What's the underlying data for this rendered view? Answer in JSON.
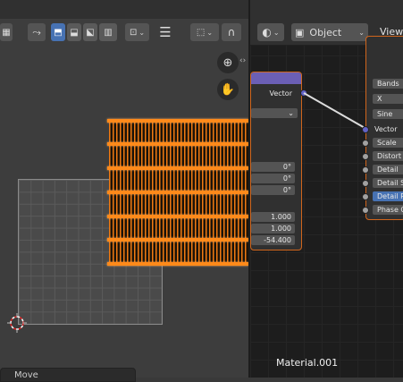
{
  "viewport": {
    "operator_label": "Move"
  },
  "node_editor": {
    "object_selector": "Object",
    "view_menu": "View",
    "material_name": "Material.001",
    "mapping_node": {
      "output_label": "Vector",
      "rotation_values": [
        "0°",
        "0°",
        "0°"
      ],
      "scale_values": [
        "1.000",
        "1.000",
        "-54.400"
      ]
    },
    "wave_node": {
      "type_value": "Bands",
      "direction_value": "X",
      "profile_value": "Sine",
      "input_vector": "Vector",
      "inputs": [
        "Scale",
        "Distort",
        "Detail",
        "Detail S",
        "Detail R",
        "Phase O"
      ]
    }
  },
  "colors": {
    "selection_orange": "#f07a12",
    "active_blue": "#4772b3",
    "header_purple": "#6b5fb5"
  }
}
